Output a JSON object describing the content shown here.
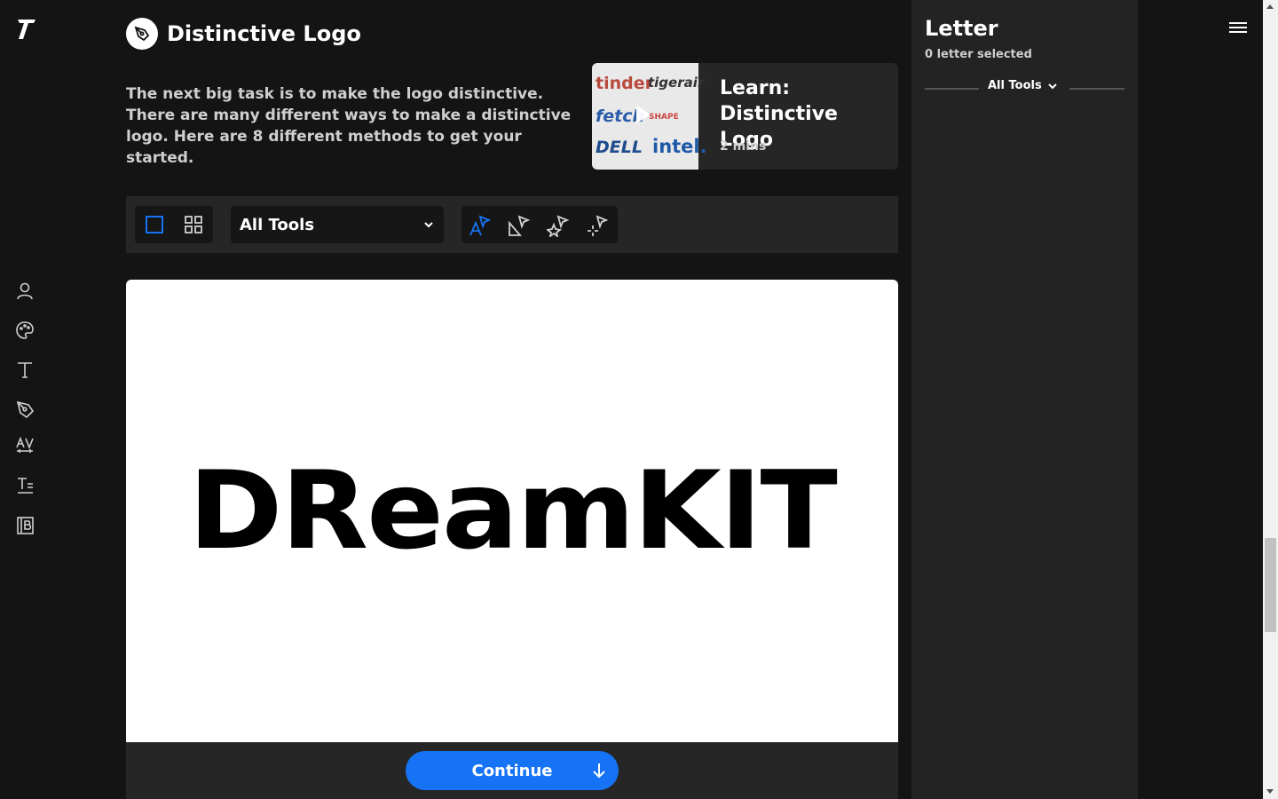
{
  "header": {
    "title": "Distinctive Logo",
    "description": "The next big task is to make the logo distinctive. There are many different ways to make a distinctive logo. Here are 8 different methods to get your started."
  },
  "learn_card": {
    "title": "Learn: Distinctive Logo",
    "duration": "2 mins",
    "thumbnail_words": [
      "tinder",
      "tigerair",
      "fetch",
      "SHAPE",
      "DELL",
      "intel."
    ]
  },
  "toolbar": {
    "view_modes": [
      "single-view",
      "grid-view"
    ],
    "active_view": "single-view",
    "tool_filter": {
      "selected": "All Tools"
    },
    "tools": [
      "letter-tool",
      "shape-tool",
      "sparkle-tool",
      "split-tool"
    ],
    "active_tool": "letter-tool"
  },
  "canvas": {
    "logo_text": "DReamKIT"
  },
  "footer": {
    "continue_label": "Continue"
  },
  "panel": {
    "title": "Letter",
    "subtitle": "0 letter selected",
    "filter_label": "All Tools"
  },
  "colors": {
    "accent": "#1673f5",
    "background": "#141414",
    "surface": "#262626",
    "panel": "#232323"
  },
  "icons": {
    "rail": [
      "type-logo-icon",
      "person-icon",
      "palette-icon",
      "text-icon",
      "pen-icon",
      "kerning-icon",
      "text-lines-icon",
      "book-icon"
    ],
    "menu": "hamburger-icon"
  }
}
